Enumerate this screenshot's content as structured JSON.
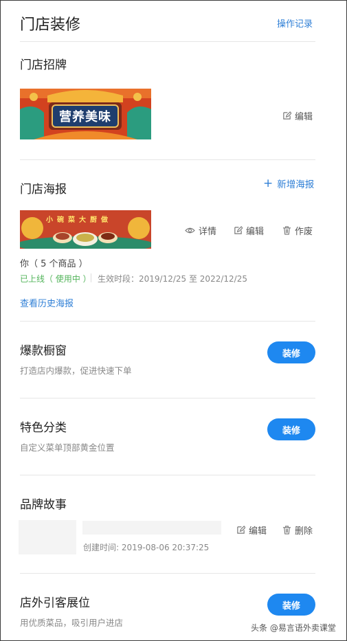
{
  "header": {
    "title": "门店装修",
    "operation_log": "操作记录"
  },
  "signboard": {
    "title": "门店招牌",
    "banner_text": "营养美味",
    "edit": "编辑"
  },
  "poster": {
    "title": "门店海报",
    "add": "新增海报",
    "chars": [
      "小",
      "碗",
      "菜",
      "大",
      "厨",
      "做"
    ],
    "details": "详情",
    "edit": "编辑",
    "void": "作废",
    "name": "你（ 5 个商品 ）",
    "status": "已上线（ 使用中 ）",
    "period": "生效时段：2019/12/25 至 2022/12/25",
    "history": "查看历史海报"
  },
  "hot_window": {
    "title": "爆款橱窗",
    "desc": "打造店内爆款，促进快速下单",
    "button": "装修"
  },
  "category": {
    "title": "特色分类",
    "desc": "自定义菜单顶部黄金位置",
    "button": "装修"
  },
  "brand_story": {
    "title": "品牌故事",
    "created": "创建时间: 2019-08-06 20:37:25",
    "edit": "编辑",
    "delete": "删除"
  },
  "outside": {
    "title": "店外引客展位",
    "desc": "用优质菜品，吸引用户进店",
    "button": "装修"
  },
  "watermark": "头条 @易言语外卖课堂",
  "colors": {
    "accent": "#1e88f0",
    "link": "#2f7fd6",
    "online": "#52b45a"
  }
}
